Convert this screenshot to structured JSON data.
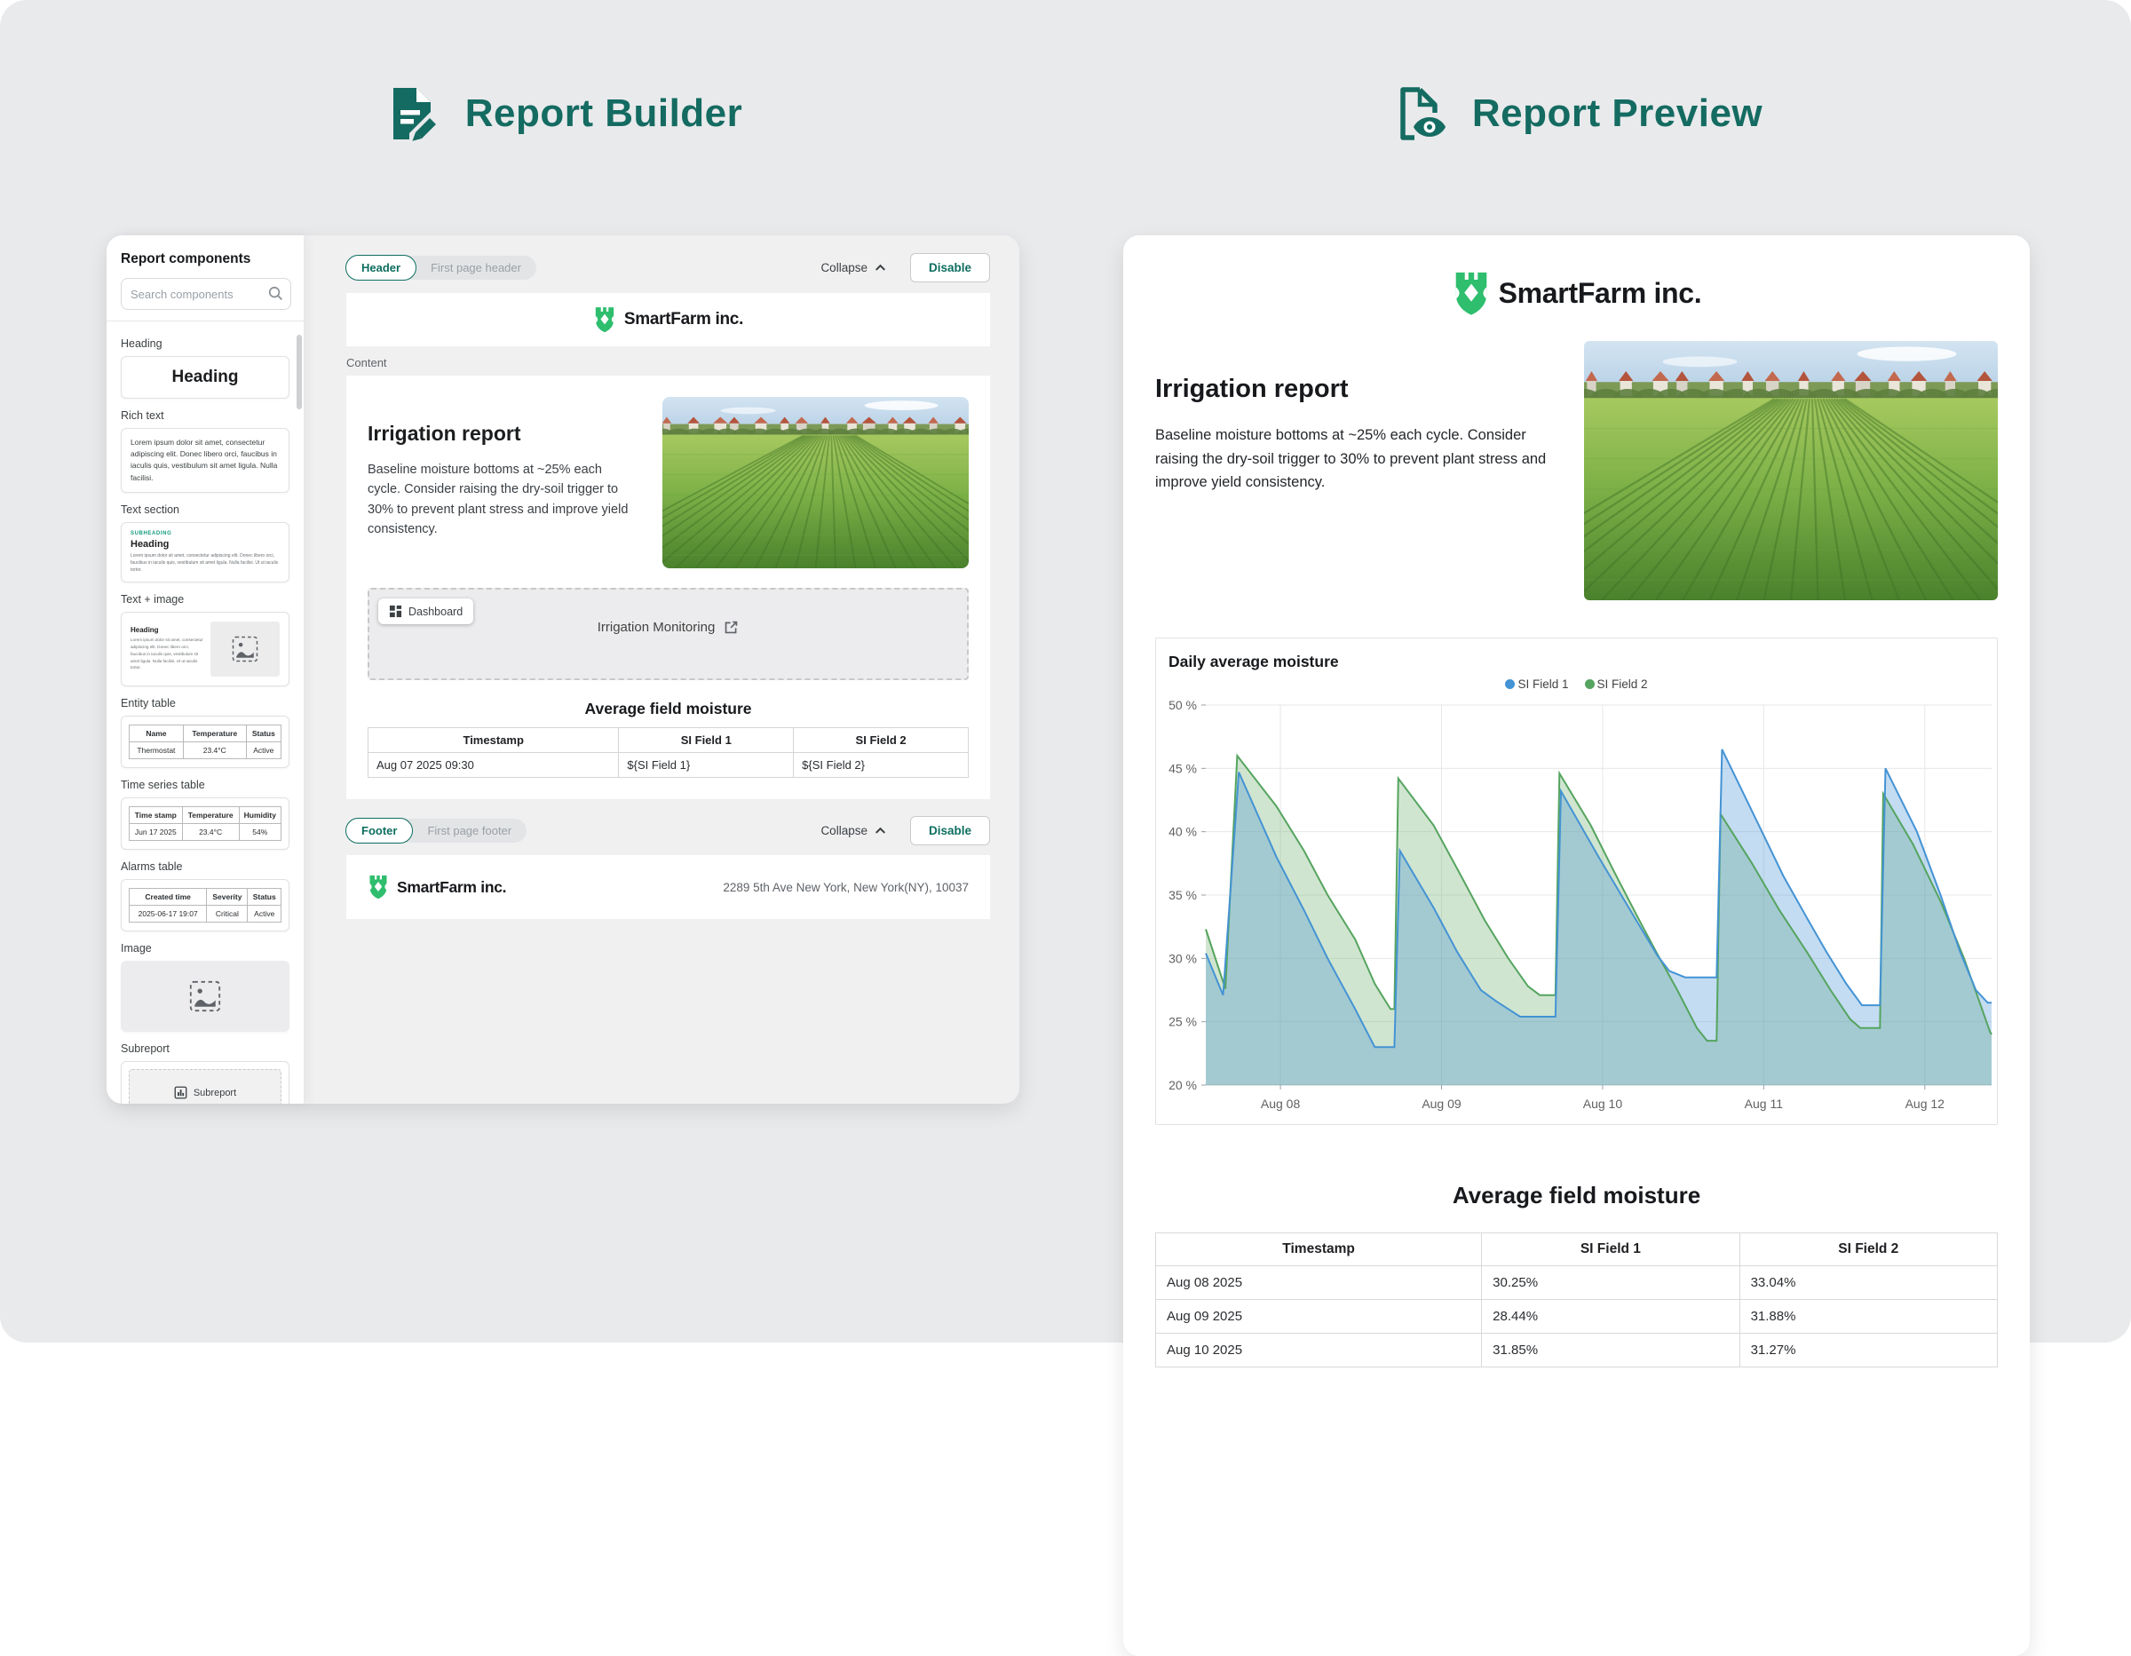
{
  "titles": {
    "builder": "Report Builder",
    "preview": "Report Preview"
  },
  "brand": {
    "name": "SmartFarm inc."
  },
  "colors": {
    "accent": "#146b61",
    "logo_green": "#2ebe6e",
    "critical_red": "#d93025",
    "chart_blue": "#4493d4",
    "chart_green": "#55a45f"
  },
  "sidebar": {
    "title": "Report components",
    "search_placeholder": "Search components",
    "components": [
      {
        "label": "Heading",
        "text": "Heading"
      },
      {
        "label": "Rich text",
        "text": "Lorem ipsum dolor sit amet, consectetur adipiscing elit. Donec libero orci, faucibus in iaculis quis, vestibulum sit amet ligula. Nulla facilisi."
      },
      {
        "label": "Text section",
        "subheading": "SUBHEADING",
        "heading": "Heading",
        "body": "Lorem ipsum dolor sit amet, consectetur adipiscing elit. Donec libero orci, faucibus in iaculis quis, vestibulum sit amet ligula. Nulla facilisi. Ut ut iaculis tortor."
      },
      {
        "label": "Text + image",
        "heading": "Heading",
        "body": "Lorem ipsum dolor sit amet, consectetur adipiscing elit. Donec libero orci, faucibus in iaculis quis, vestibulum sit amet ligula. Nulla facilisi. Ut ut iaculis tortor."
      },
      {
        "label": "Entity table",
        "headers": [
          "Name",
          "Temperature",
          "Status"
        ],
        "row": [
          "Thermostat",
          "23.4°C",
          "Active"
        ]
      },
      {
        "label": "Time series table",
        "headers": [
          "Time stamp",
          "Temperature",
          "Humidity"
        ],
        "row": [
          "Jun 17 2025",
          "23.4°C",
          "54%"
        ]
      },
      {
        "label": "Alarms table",
        "headers": [
          "Created time",
          "Severity",
          "Status"
        ],
        "row": [
          "2025-06-17 19:07",
          "Critical",
          "Active"
        ]
      },
      {
        "label": "Image"
      },
      {
        "label": "Subreport",
        "text": "Subreport"
      }
    ]
  },
  "builder": {
    "header_tabs": {
      "active": "Header",
      "inactive": "First page header"
    },
    "footer_tabs": {
      "active": "Footer",
      "inactive": "First page footer"
    },
    "collapse_label": "Collapse",
    "disable_label": "Disable",
    "content_label": "Content",
    "report": {
      "heading": "Irrigation report",
      "body": "Baseline moisture bottoms at ~25% each cycle. Consider raising the dry-soil trigger to 30% to prevent plant stress and improve yield consistency.",
      "dashboard_chip": "Dashboard",
      "dashboard_link": "Irrigation Monitoring",
      "table_title": "Average field moisture",
      "table": {
        "headers": [
          "Timestamp",
          "SI Field 1",
          "SI Field 2"
        ],
        "rows": [
          [
            "Aug 07 2025 09:30",
            "${SI Field 1}",
            "${SI Field 2}"
          ]
        ]
      }
    },
    "footer_address": "2289 5th Ave New York, New York(NY), 10037"
  },
  "preview": {
    "heading": "Irrigation report",
    "body": "Baseline moisture bottoms at ~25% each cycle. Consider raising the dry-soil trigger to 30% to prevent plant stress and improve yield consistency.",
    "table_title": "Average field moisture",
    "table": {
      "headers": [
        "Timestamp",
        "SI Field 1",
        "SI Field 2"
      ],
      "rows": [
        [
          "Aug 08 2025",
          "30.25%",
          "33.04%"
        ],
        [
          "Aug 09 2025",
          "28.44%",
          "31.88%"
        ],
        [
          "Aug 10 2025",
          "31.85%",
          "31.27%"
        ]
      ]
    }
  },
  "chart_data": {
    "type": "area",
    "title": "Daily average moisture",
    "legend_position": "top-center",
    "grid": true,
    "y_unit": "%",
    "ylim": [
      20,
      50
    ],
    "y_ticks": [
      20,
      25,
      30,
      35,
      40,
      45,
      50
    ],
    "x_ticks": [
      {
        "frac": 0.095,
        "label": "Aug 08"
      },
      {
        "frac": 0.3,
        "label": "Aug 09"
      },
      {
        "frac": 0.505,
        "label": "Aug 10"
      },
      {
        "frac": 0.71,
        "label": "Aug 11"
      },
      {
        "frac": 0.915,
        "label": "Aug 12"
      }
    ],
    "series": [
      {
        "name": "SI Field 1",
        "color": "#4493d4",
        "fill": "rgba(68,147,212,0.32)",
        "points": [
          [
            0,
            30.4
          ],
          [
            0.022,
            27.1
          ],
          [
            0.042,
            44.7
          ],
          [
            0.09,
            38
          ],
          [
            0.125,
            33.8
          ],
          [
            0.155,
            30
          ],
          [
            0.19,
            26
          ],
          [
            0.215,
            23
          ],
          [
            0.24,
            23
          ],
          [
            0.247,
            38.5
          ],
          [
            0.29,
            34
          ],
          [
            0.32,
            30.5
          ],
          [
            0.35,
            27.5
          ],
          [
            0.37,
            26.6
          ],
          [
            0.4,
            25.4
          ],
          [
            0.445,
            25.4
          ],
          [
            0.452,
            43.2
          ],
          [
            0.5,
            38
          ],
          [
            0.545,
            33.3
          ],
          [
            0.575,
            30.2
          ],
          [
            0.59,
            29
          ],
          [
            0.61,
            28.5
          ],
          [
            0.65,
            28.5
          ],
          [
            0.657,
            46.5
          ],
          [
            0.7,
            41
          ],
          [
            0.735,
            36.5
          ],
          [
            0.765,
            33.2
          ],
          [
            0.79,
            30.5
          ],
          [
            0.815,
            28
          ],
          [
            0.835,
            26.3
          ],
          [
            0.858,
            26.3
          ],
          [
            0.865,
            45
          ],
          [
            0.905,
            40
          ],
          [
            0.935,
            35
          ],
          [
            0.96,
            30.5
          ],
          [
            0.98,
            27.5
          ],
          [
            0.995,
            26.5
          ],
          [
            1,
            26.5
          ]
        ]
      },
      {
        "name": "SI Field 2",
        "color": "#55a45f",
        "fill": "rgba(109,175,108,0.32)",
        "points": [
          [
            0,
            32.3
          ],
          [
            0.025,
            27.6
          ],
          [
            0.04,
            46
          ],
          [
            0.09,
            42
          ],
          [
            0.125,
            38.5
          ],
          [
            0.155,
            35
          ],
          [
            0.19,
            31.5
          ],
          [
            0.215,
            28
          ],
          [
            0.235,
            26
          ],
          [
            0.24,
            26
          ],
          [
            0.245,
            44.2
          ],
          [
            0.29,
            40.5
          ],
          [
            0.325,
            36.5
          ],
          [
            0.355,
            33
          ],
          [
            0.385,
            30
          ],
          [
            0.41,
            27.8
          ],
          [
            0.425,
            27.1
          ],
          [
            0.445,
            27.1
          ],
          [
            0.45,
            44.6
          ],
          [
            0.49,
            40.5
          ],
          [
            0.52,
            36.8
          ],
          [
            0.55,
            33.2
          ],
          [
            0.575,
            30.3
          ],
          [
            0.6,
            27.5
          ],
          [
            0.625,
            24.5
          ],
          [
            0.638,
            23.5
          ],
          [
            0.65,
            23.5
          ],
          [
            0.655,
            41.4
          ],
          [
            0.695,
            37.5
          ],
          [
            0.73,
            33.8
          ],
          [
            0.765,
            30.5
          ],
          [
            0.795,
            27.5
          ],
          [
            0.82,
            25.2
          ],
          [
            0.833,
            24.5
          ],
          [
            0.858,
            24.5
          ],
          [
            0.862,
            43
          ],
          [
            0.9,
            39
          ],
          [
            0.935,
            34.5
          ],
          [
            0.965,
            30
          ],
          [
            0.985,
            26.5
          ],
          [
            0.998,
            24.2
          ],
          [
            1,
            24
          ]
        ]
      }
    ]
  }
}
